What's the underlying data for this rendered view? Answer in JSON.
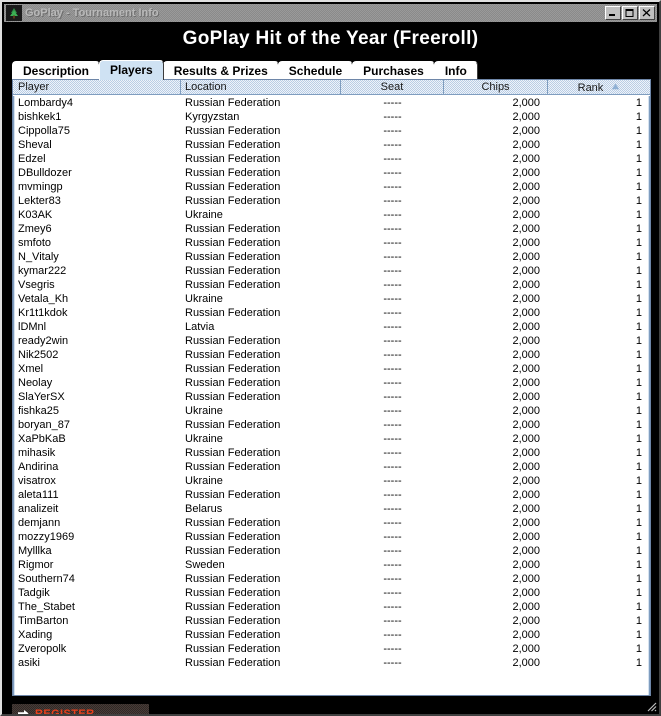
{
  "window": {
    "title": "GoPlay - Tournament Info",
    "icon": "goplay-logo-icon",
    "minimize_label": "_",
    "maximize_label": "□",
    "close_label": "✕"
  },
  "header": {
    "tournament_title": "GoPlay Hit of the Year (Freeroll)"
  },
  "tabs": [
    {
      "label": "Description",
      "selected": false
    },
    {
      "label": "Players",
      "selected": true
    },
    {
      "label": "Results & Prizes",
      "selected": false
    },
    {
      "label": "Schedule",
      "selected": false
    },
    {
      "label": "Purchases",
      "selected": false
    },
    {
      "label": "Info",
      "selected": false
    }
  ],
  "table": {
    "columns": [
      {
        "key": "player",
        "label": "Player",
        "sorted": false
      },
      {
        "key": "location",
        "label": "Location",
        "sorted": false
      },
      {
        "key": "seat",
        "label": "Seat",
        "sorted": false
      },
      {
        "key": "chips",
        "label": "Chips",
        "sorted": false
      },
      {
        "key": "rank",
        "label": "Rank",
        "sorted": true,
        "sort_direction": "ascending"
      }
    ],
    "rows": [
      {
        "player": "Lombardy4",
        "location": "Russian Federation",
        "seat": "-----",
        "chips": "2,000",
        "rank": "1"
      },
      {
        "player": "bishkek1",
        "location": "Kyrgyzstan",
        "seat": "-----",
        "chips": "2,000",
        "rank": "1"
      },
      {
        "player": "Cippolla75",
        "location": "Russian Federation",
        "seat": "-----",
        "chips": "2,000",
        "rank": "1"
      },
      {
        "player": "Sheval",
        "location": "Russian Federation",
        "seat": "-----",
        "chips": "2,000",
        "rank": "1"
      },
      {
        "player": "Edzel",
        "location": "Russian Federation",
        "seat": "-----",
        "chips": "2,000",
        "rank": "1"
      },
      {
        "player": "DBulldozer",
        "location": "Russian Federation",
        "seat": "-----",
        "chips": "2,000",
        "rank": "1"
      },
      {
        "player": "mvmingp",
        "location": "Russian Federation",
        "seat": "-----",
        "chips": "2,000",
        "rank": "1"
      },
      {
        "player": "Lekter83",
        "location": "Russian Federation",
        "seat": "-----",
        "chips": "2,000",
        "rank": "1"
      },
      {
        "player": "K03AK",
        "location": "Ukraine",
        "seat": "-----",
        "chips": "2,000",
        "rank": "1"
      },
      {
        "player": "Zmey6",
        "location": "Russian Federation",
        "seat": "-----",
        "chips": "2,000",
        "rank": "1"
      },
      {
        "player": "smfoto",
        "location": "Russian Federation",
        "seat": "-----",
        "chips": "2,000",
        "rank": "1"
      },
      {
        "player": "N_Vitaly",
        "location": "Russian Federation",
        "seat": "-----",
        "chips": "2,000",
        "rank": "1"
      },
      {
        "player": "kymar222",
        "location": "Russian Federation",
        "seat": "-----",
        "chips": "2,000",
        "rank": "1"
      },
      {
        "player": "Vsegris",
        "location": "Russian Federation",
        "seat": "-----",
        "chips": "2,000",
        "rank": "1"
      },
      {
        "player": "Vetala_Kh",
        "location": "Ukraine",
        "seat": "-----",
        "chips": "2,000",
        "rank": "1"
      },
      {
        "player": "Kr1t1kdok",
        "location": "Russian Federation",
        "seat": "-----",
        "chips": "2,000",
        "rank": "1"
      },
      {
        "player": "lDMnl",
        "location": "Latvia",
        "seat": "-----",
        "chips": "2,000",
        "rank": "1"
      },
      {
        "player": "ready2win",
        "location": "Russian Federation",
        "seat": "-----",
        "chips": "2,000",
        "rank": "1"
      },
      {
        "player": "Nik2502",
        "location": "Russian Federation",
        "seat": "-----",
        "chips": "2,000",
        "rank": "1"
      },
      {
        "player": "Xmel",
        "location": "Russian Federation",
        "seat": "-----",
        "chips": "2,000",
        "rank": "1"
      },
      {
        "player": "Neolay",
        "location": "Russian Federation",
        "seat": "-----",
        "chips": "2,000",
        "rank": "1"
      },
      {
        "player": "SlaYerSX",
        "location": "Russian Federation",
        "seat": "-----",
        "chips": "2,000",
        "rank": "1"
      },
      {
        "player": "fishka25",
        "location": "Ukraine",
        "seat": "-----",
        "chips": "2,000",
        "rank": "1"
      },
      {
        "player": "boryan_87",
        "location": "Russian Federation",
        "seat": "-----",
        "chips": "2,000",
        "rank": "1"
      },
      {
        "player": "XaPbKaB",
        "location": "Ukraine",
        "seat": "-----",
        "chips": "2,000",
        "rank": "1"
      },
      {
        "player": "mihasik",
        "location": "Russian Federation",
        "seat": "-----",
        "chips": "2,000",
        "rank": "1"
      },
      {
        "player": "Andirina",
        "location": "Russian Federation",
        "seat": "-----",
        "chips": "2,000",
        "rank": "1"
      },
      {
        "player": "visatrox",
        "location": "Ukraine",
        "seat": "-----",
        "chips": "2,000",
        "rank": "1"
      },
      {
        "player": "aleta111",
        "location": "Russian Federation",
        "seat": "-----",
        "chips": "2,000",
        "rank": "1"
      },
      {
        "player": "analizeit",
        "location": "Belarus",
        "seat": "-----",
        "chips": "2,000",
        "rank": "1"
      },
      {
        "player": "demjann",
        "location": "Russian Federation",
        "seat": "-----",
        "chips": "2,000",
        "rank": "1"
      },
      {
        "player": "mozzy1969",
        "location": "Russian Federation",
        "seat": "-----",
        "chips": "2,000",
        "rank": "1"
      },
      {
        "player": "Mylllka",
        "location": "Russian Federation",
        "seat": "-----",
        "chips": "2,000",
        "rank": "1"
      },
      {
        "player": "Rigmor",
        "location": "Sweden",
        "seat": "-----",
        "chips": "2,000",
        "rank": "1"
      },
      {
        "player": "Southern74",
        "location": "Russian Federation",
        "seat": "-----",
        "chips": "2,000",
        "rank": "1"
      },
      {
        "player": "Tadgik",
        "location": "Russian Federation",
        "seat": "-----",
        "chips": "2,000",
        "rank": "1"
      },
      {
        "player": "The_Stabet",
        "location": "Russian Federation",
        "seat": "-----",
        "chips": "2,000",
        "rank": "1"
      },
      {
        "player": "TimBarton",
        "location": "Russian Federation",
        "seat": "-----",
        "chips": "2,000",
        "rank": "1"
      },
      {
        "player": "Xading",
        "location": "Russian Federation",
        "seat": "-----",
        "chips": "2,000",
        "rank": "1"
      },
      {
        "player": "Zveropolk",
        "location": "Russian Federation",
        "seat": "-----",
        "chips": "2,000",
        "rank": "1"
      },
      {
        "player": "asiki",
        "location": "Russian Federation",
        "seat": "-----",
        "chips": "2,000",
        "rank": "1"
      }
    ]
  },
  "footer": {
    "register_label": "REGISTER",
    "register_icon": "arrow-right-icon"
  },
  "colors": {
    "window_background": "#000000",
    "titlebar": "#9a9a9a",
    "tab_selected": "#cfe2f3",
    "tab_unselected": "#ffffff",
    "grid_header": "#dbe6f4",
    "register_text": "#e8401c",
    "title_text": "#ffffff"
  }
}
